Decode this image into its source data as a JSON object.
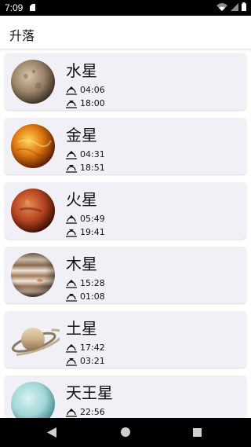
{
  "status_bar": {
    "time": "7:09",
    "icons": [
      "sd-card-icon",
      "wifi-icon",
      "signal-icon",
      "battery-icon"
    ]
  },
  "app_bar": {
    "title": "升落"
  },
  "planets": [
    {
      "name": "水星",
      "rise": "04:06",
      "set": "18:00",
      "image": "mercury"
    },
    {
      "name": "金星",
      "rise": "04:31",
      "set": "18:51",
      "image": "venus"
    },
    {
      "name": "火星",
      "rise": "05:49",
      "set": "19:41",
      "image": "mars"
    },
    {
      "name": "木星",
      "rise": "15:28",
      "set": "01:08",
      "image": "jupiter"
    },
    {
      "name": "土星",
      "rise": "17:42",
      "set": "03:21",
      "image": "saturn"
    },
    {
      "name": "天王星",
      "rise": "22:56",
      "set": "",
      "image": "uranus"
    }
  ],
  "icons": {
    "rise": "sunrise-icon",
    "set": "sunset-icon"
  },
  "nav_bar": {
    "buttons": [
      "back-icon",
      "home-icon",
      "recents-icon"
    ]
  },
  "colors": {
    "card_bg": "#f1f0f6",
    "text": "#111111"
  }
}
